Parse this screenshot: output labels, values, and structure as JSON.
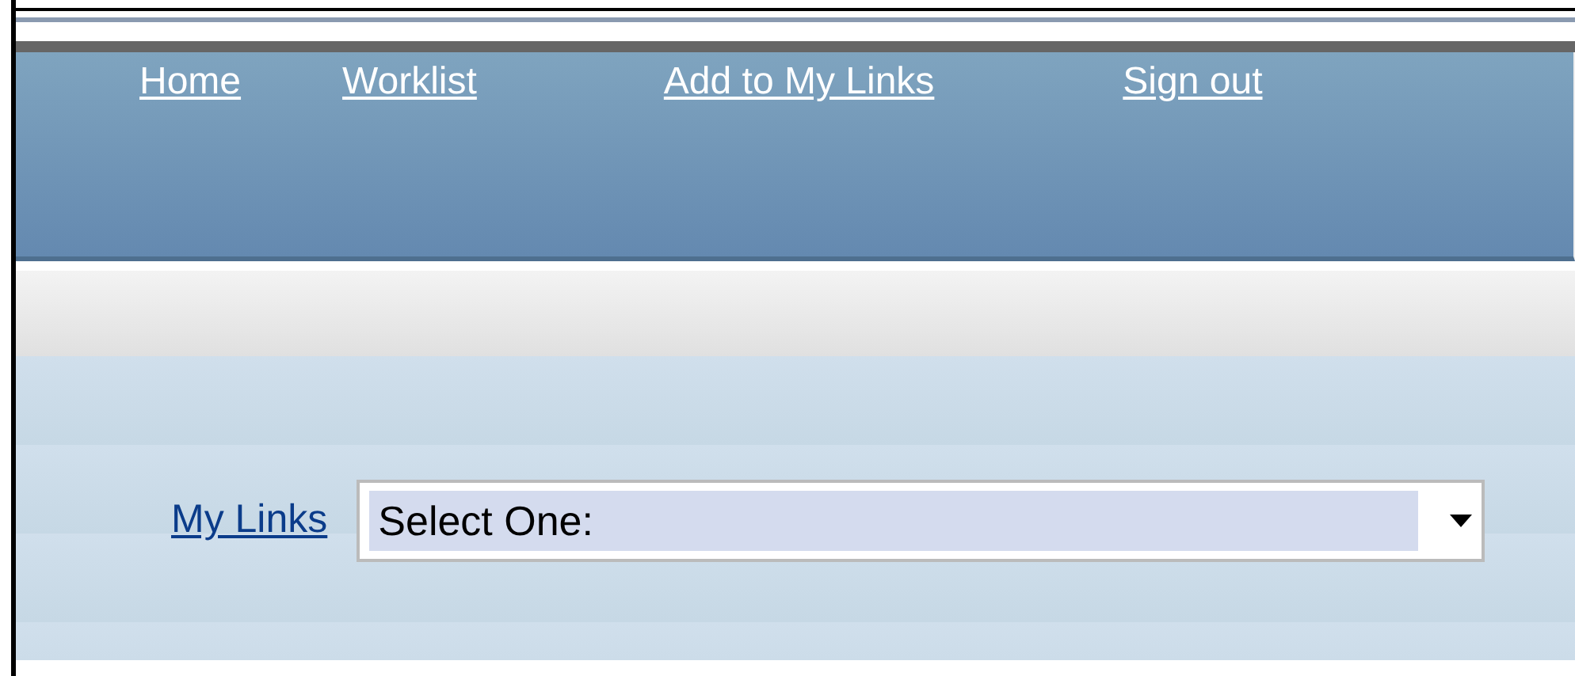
{
  "nav_links": [
    "Home",
    "Worklist",
    "Add to My Links",
    "Sign out"
  ],
  "my_links": {
    "label": "My Links",
    "select": {
      "value": "Select One:"
    }
  }
}
